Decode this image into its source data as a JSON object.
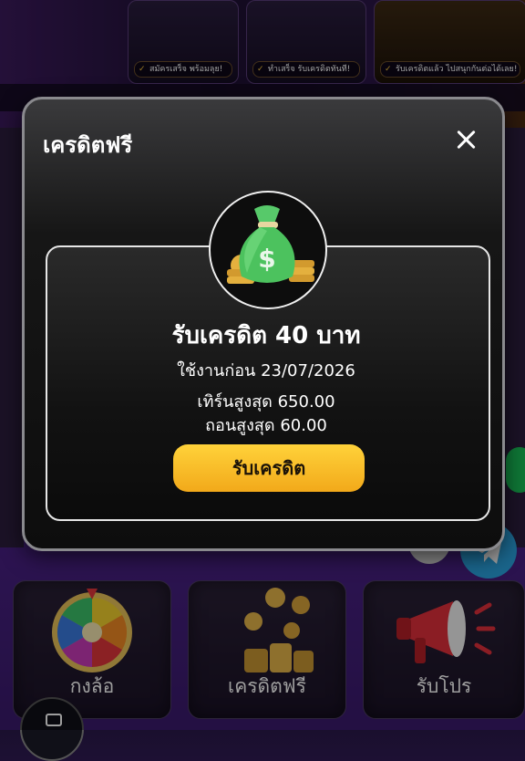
{
  "background": {
    "banner_captions": [
      "สมัครเสร็จ พร้อมลุย!",
      "ทำเสร็จ รับเครดิตทันที!",
      "รับเครดิตแล้ว ไปสนุกกันต่อได้เลย!"
    ]
  },
  "modal": {
    "title": "เครดิตฟรี",
    "close_icon": "close-icon",
    "reward_icon": "money-bag-icon",
    "credit_title": "รับเครดิต 40 บาท",
    "expire_text": "ใช้งานก่อน 23/07/2026",
    "max_turnover_text": "เทิร์นสูงสุด 650.00",
    "max_withdraw_text": "ถอนสูงสุด 60.00",
    "claim_button": "รับเครดิต"
  },
  "menu_tiles": [
    {
      "label": "กงล้อ",
      "icon": "prize-wheel-icon"
    },
    {
      "label": "เครดิตฟรี",
      "icon": "coins-icon"
    },
    {
      "label": "รับโปร",
      "icon": "megaphone-icon"
    }
  ],
  "colors": {
    "accent_yellow": "#f5b82a",
    "modal_bg": "#111111",
    "page_purple": "#3a1a68",
    "telegram_blue": "#2aa3e0"
  }
}
